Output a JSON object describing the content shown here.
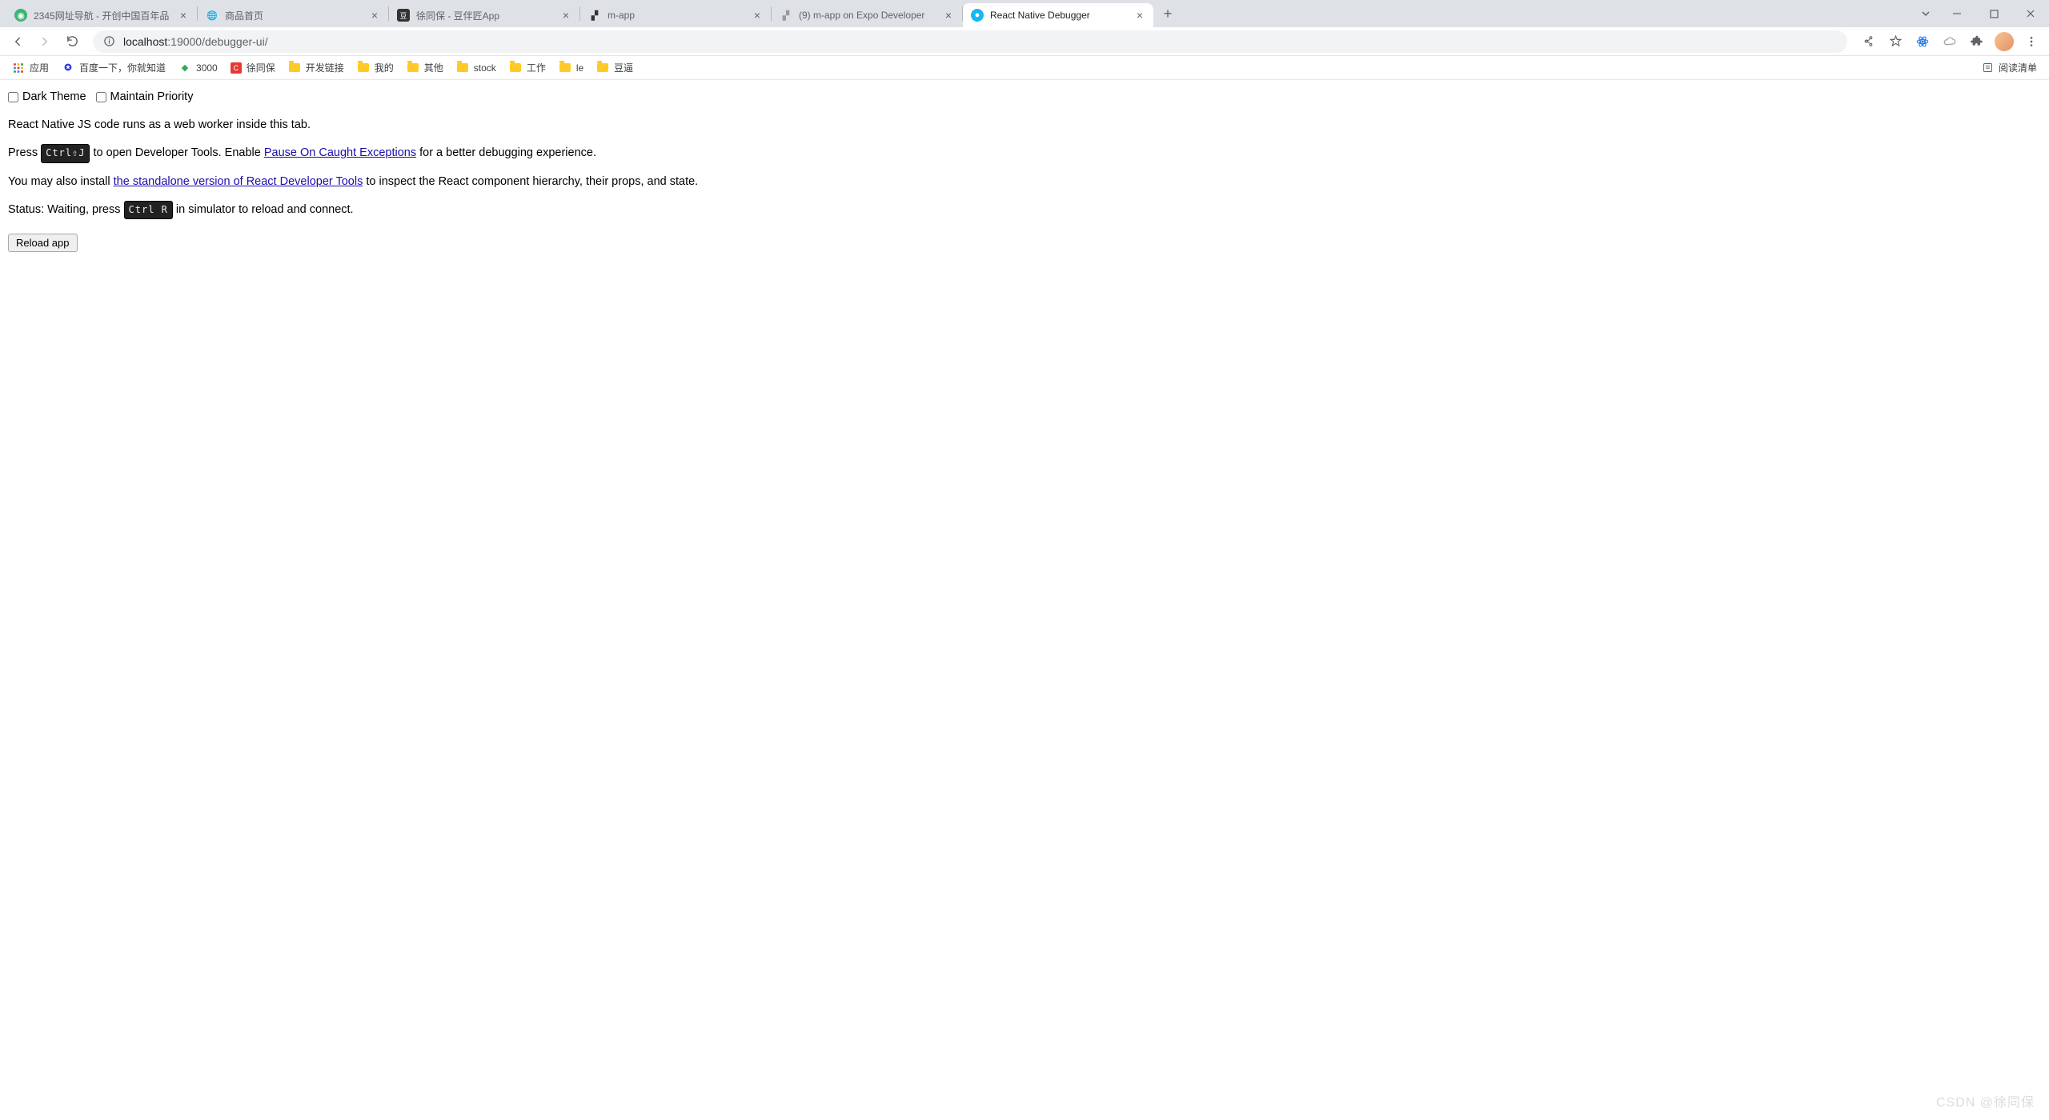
{
  "tabs": [
    {
      "title": "2345网址导航 - 开创中国百年品",
      "favicon": "globe-green"
    },
    {
      "title": "商品首页",
      "favicon": "globe-gray"
    },
    {
      "title": "徐同保 - 豆伴匠App",
      "favicon": "square-dark"
    },
    {
      "title": "m-app",
      "favicon": "expo"
    },
    {
      "title": "(9) m-app on Expo Developer",
      "favicon": "expo-light"
    },
    {
      "title": "React Native Debugger",
      "favicon": "circle-blue",
      "active": true
    }
  ],
  "url": {
    "host": "localhost",
    "port": ":19000",
    "path": "/debugger-ui/"
  },
  "bookmarks": [
    {
      "label": "应用",
      "icon": "apps"
    },
    {
      "label": "百度一下，你就知道",
      "icon": "baidu"
    },
    {
      "label": "3000",
      "icon": "green-dot"
    },
    {
      "label": "徐同保",
      "icon": "red-c"
    },
    {
      "label": "开发链接",
      "icon": "folder"
    },
    {
      "label": "我的",
      "icon": "folder"
    },
    {
      "label": "其他",
      "icon": "folder"
    },
    {
      "label": "stock",
      "icon": "folder"
    },
    {
      "label": "工作",
      "icon": "folder"
    },
    {
      "label": "le",
      "icon": "folder"
    },
    {
      "label": "豆逼",
      "icon": "folder"
    }
  ],
  "reading_list_label": "阅读清单",
  "page": {
    "dark_theme_label": "Dark Theme",
    "maintain_priority_label": "Maintain Priority",
    "line1": "React Native JS code runs as a web worker inside this tab.",
    "line2_a": "Press ",
    "line2_kbd": "Ctrl⇧J",
    "line2_b": " to open Developer Tools. Enable ",
    "line2_link": "Pause On Caught Exceptions",
    "line2_c": " for a better debugging experience.",
    "line3_a": "You may also install ",
    "line3_link": "the standalone version of React Developer Tools",
    "line3_b": " to inspect the React component hierarchy, their props, and state.",
    "line4_a": "Status: Waiting, press ",
    "line4_kbd": "Ctrl R",
    "line4_b": " in simulator to reload and connect.",
    "reload_btn": "Reload app"
  },
  "watermark": "CSDN @徐同保"
}
